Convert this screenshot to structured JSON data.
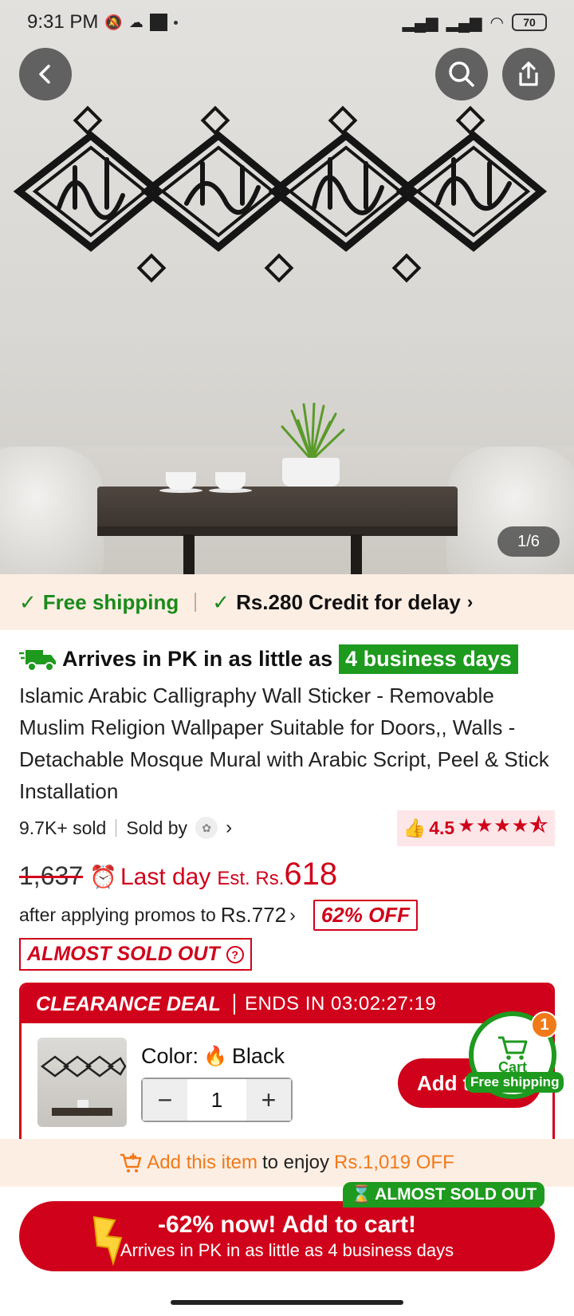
{
  "status_bar": {
    "time": "9:31 PM",
    "battery": "70"
  },
  "hero": {
    "image_counter": "1/6",
    "buttons": {
      "back": "back",
      "search": "search",
      "share": "share"
    }
  },
  "shipping_strip": {
    "free_shipping": "Free shipping",
    "credit_delay": "Rs.280 Credit for delay"
  },
  "product": {
    "arrive_prefix": "Arrives in PK in as little as",
    "arrive_days": "4 business days",
    "title": "Islamic Arabic Calligraphy Wall Sticker - Removable Muslim Religion Wallpaper Suitable for Doors,, Walls - Detachable Mosque Mural with Arabic Script, Peel & Stick Installation",
    "sold_count": "9.7K+ sold",
    "sold_by": "Sold by",
    "rating": "4.5",
    "rating_stars": 4.5,
    "original_price": "1,637",
    "last_day": "Last day",
    "est_label": "Est. Rs.",
    "final_price": "618",
    "promo_text": "after applying promos to",
    "promo_price": "Rs.772",
    "off_badge": "62% OFF",
    "almost_sold_out": "ALMOST SOLD OUT"
  },
  "clearance": {
    "title": "CLEARANCE DEAL",
    "ends_label": "ENDS IN",
    "countdown": "03:02:27:19",
    "color_label": "Color:",
    "color_value": "Black",
    "quantity": "1",
    "add_button": "Add t"
  },
  "cart_fab": {
    "label": "Cart",
    "count": "1",
    "shipping": "Free shipping"
  },
  "enjoy_bar": {
    "add_item": "Add this item",
    "to_enjoy": "to enjoy",
    "off_amount": "Rs.1,019 OFF"
  },
  "bottom_cta": {
    "tag": "ALMOST SOLD OUT",
    "main": "-62% now! Add to cart!",
    "sub": "Arrives in PK in as little as 4 business days"
  },
  "colors": {
    "brand_red": "#d0021b",
    "green": "#1e9a1e",
    "orange": "#f07a1a",
    "cream": "#fdeee4"
  }
}
